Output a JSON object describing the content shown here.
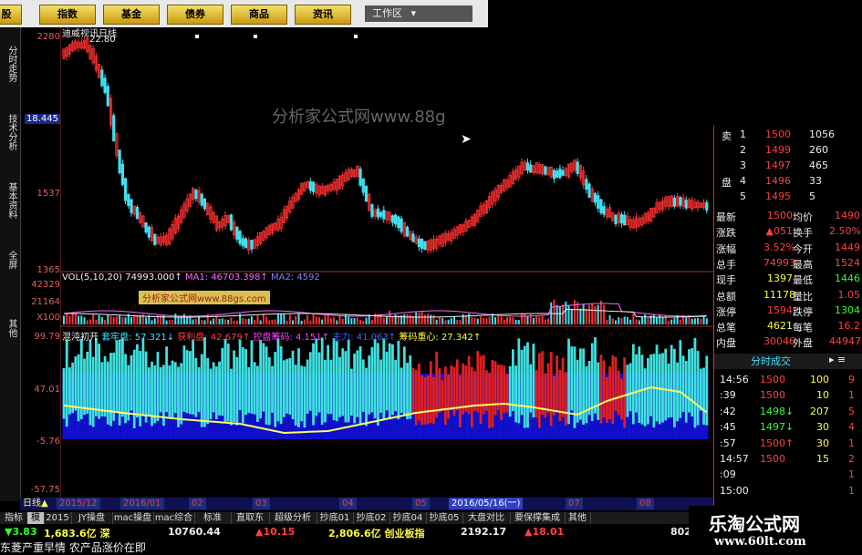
{
  "menu": {
    "items": [
      "股",
      "指数",
      "基金",
      "债券",
      "商品",
      "资讯"
    ],
    "workarea": "工作区"
  },
  "sidebar": {
    "tabs": [
      "分时走势",
      "技术分析",
      "基本资料",
      "全屏",
      "其他"
    ]
  },
  "chart": {
    "title": "迪威视讯日线",
    "high_label": "22.80",
    "watermark": "分析家公式网www.88g",
    "price_axis": [
      "2280",
      "18.445",
      "1537",
      "1365"
    ],
    "vol_axis": [
      "42329",
      "21164",
      "X100"
    ],
    "ind_axis": [
      "99.79",
      "47.01",
      "-5.76",
      "-57.75"
    ],
    "vol_legend": {
      "prefix": "VOL(5,10,20)",
      "v1": "74993.000↑",
      "ma1": "MA1: 46703.398↑",
      "ma2": "MA2: 4592"
    },
    "vol_watermark": "分析家公式网www.88gs.com",
    "ind_legend": {
      "name": "混沌初开",
      "a_label": "套牢盘:",
      "a_val": "57.321↓",
      "b_label": "获利盘:",
      "b_val": "42.679↑",
      "c_label": "控盘筹码:",
      "c_val": "4.151↑",
      "d_label": "主力:",
      "d_val": "41.063↑",
      "e_label": "筹码重心:",
      "e_val": "27.342↑"
    },
    "ind_badge": "39",
    "ind_badge_pct": "%",
    "dates": [
      "2015/12",
      "2016/01",
      "02",
      "03",
      "04",
      "05",
      "2016/05/16(一)",
      "07",
      "08"
    ],
    "period_label": "日线"
  },
  "chart_data": {
    "type": "candlestick",
    "title": "迪威视讯日线",
    "y_axis_ticks": [
      22.8,
      18.445,
      15.37,
      13.65
    ],
    "x_ticks": [
      "2015/12",
      "2016/01",
      "02",
      "03",
      "04",
      "05",
      "2016/05/16(一)",
      "07",
      "08"
    ]
  },
  "quote": {
    "order_book": [
      {
        "side": "卖",
        "lvl": "1",
        "price": "1500",
        "vol": "1056"
      },
      {
        "side": "",
        "lvl": "2",
        "price": "1499",
        "vol": "260"
      },
      {
        "side": "",
        "lvl": "3",
        "price": "1497",
        "vol": "465"
      },
      {
        "side": "盘",
        "lvl": "4",
        "price": "1496",
        "vol": "33"
      },
      {
        "side": "",
        "lvl": "5",
        "price": "1495",
        "vol": "5"
      }
    ],
    "stats": [
      {
        "k1": "最新",
        "v1": "1500",
        "k2": "均价",
        "v2": "1490"
      },
      {
        "k1": "涨跌",
        "v1": "▲051",
        "k2": "换手",
        "v2": "2.50%"
      },
      {
        "k1": "涨幅",
        "v1": "3.52%",
        "k2": "今开",
        "v2": "1449"
      },
      {
        "k1": "总手",
        "v1": "74993",
        "k2": "最高",
        "v2": "1524"
      },
      {
        "k1": "现手",
        "v1": "1397",
        "k2": "最低",
        "v2": "1446"
      },
      {
        "k1": "总额",
        "v1": "11178",
        "k2": "量比",
        "v2": "1.05"
      },
      {
        "k1": "涨停",
        "v1": "1594",
        "k2": "跌停",
        "v2": "1304"
      },
      {
        "k1": "总笔",
        "v1": "4621",
        "k2": "每笔",
        "v2": "16.2"
      },
      {
        "k1": "内盘",
        "v1": "30046",
        "k2": "外盘",
        "v2": "44947"
      }
    ],
    "tick_header": "分时成交",
    "ticks": [
      {
        "t": "14:56",
        "p": "1500",
        "v": "100",
        "n": "9"
      },
      {
        "t": ":39",
        "p": "1500",
        "v": "10",
        "n": "1"
      },
      {
        "t": ":42",
        "p": "1498↓",
        "v": "207",
        "n": "5"
      },
      {
        "t": ":45",
        "p": "1497↓",
        "v": "30",
        "n": "4"
      },
      {
        "t": ":57",
        "p": "1500↑",
        "v": "30",
        "n": "1"
      },
      {
        "t": "14:57",
        "p": "1500",
        "v": "15",
        "n": "2"
      },
      {
        "t": ":09",
        "p": "",
        "v": "",
        "n": "1"
      },
      {
        "t": "15:00",
        "p": "",
        "v": "",
        "n": "1"
      }
    ]
  },
  "bottom_tabs": [
    "指标",
    "模版",
    "2015",
    "JY操盘",
    "mac操盘",
    "mac综合",
    "标准",
    "直取东",
    "超级分析",
    "抄底01",
    "抄底02",
    "抄底04",
    "抄底05",
    "大盘对比",
    "要保撑集成",
    "其他"
  ],
  "ticker": [
    {
      "t": "▼3.83",
      "c": "green"
    },
    {
      "t": "1,683.6亿 深",
      "c": "yellow"
    },
    {
      "t": "10760.44",
      "c": "white"
    },
    {
      "t": "▲10.15",
      "c": "red"
    },
    {
      "t": "2,806.6亿 创业板指",
      "c": "yellow"
    },
    {
      "t": "2192.17",
      "c": "white"
    },
    {
      "t": "▲18.01",
      "c": "red"
    },
    {
      "t": "802",
      "c": "white"
    }
  ],
  "news": "东菱产重早情 农产品涨价在即",
  "brand": {
    "cn": "乐淘公式网",
    "url": "www.60lt.com"
  }
}
